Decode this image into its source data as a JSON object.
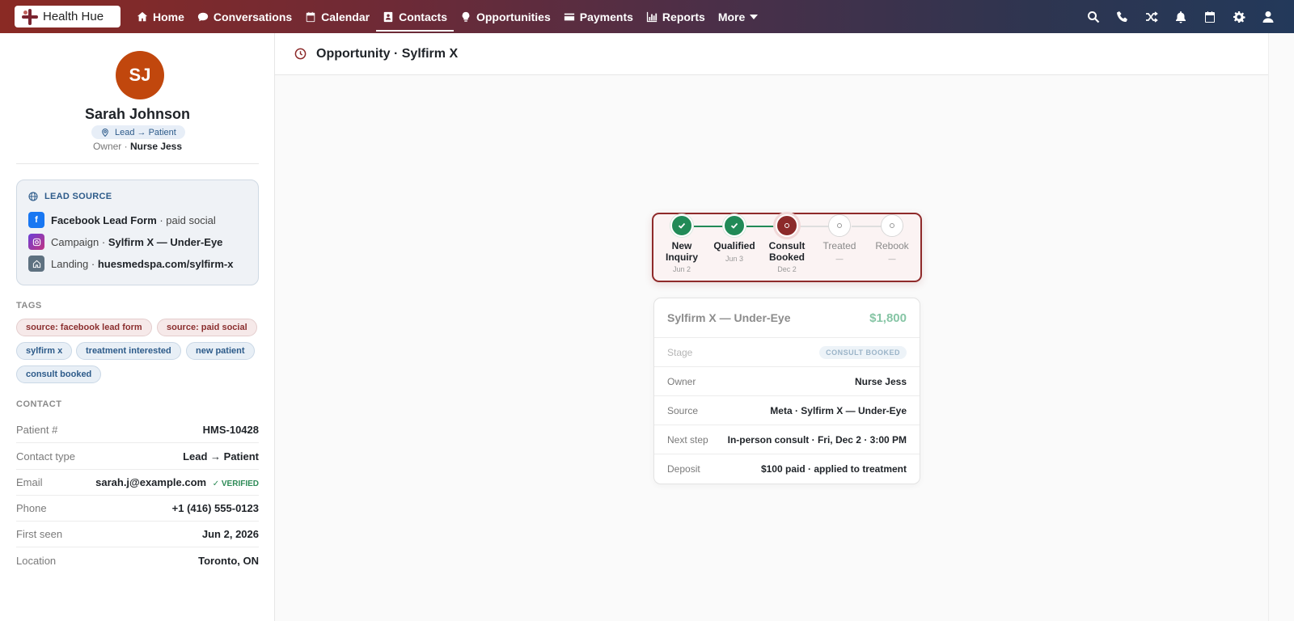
{
  "brand": {
    "name": "Health Hue"
  },
  "nav": {
    "items": [
      {
        "label": "Home",
        "icon": "home-icon"
      },
      {
        "label": "Conversations",
        "icon": "chat-icon"
      },
      {
        "label": "Calendar",
        "icon": "calendar-icon"
      },
      {
        "label": "Contacts",
        "icon": "contacts-icon",
        "active": true
      },
      {
        "label": "Opportunities",
        "icon": "lightbulb-icon"
      },
      {
        "label": "Payments",
        "icon": "credit-card-icon"
      },
      {
        "label": "Reports",
        "icon": "bar-chart-icon"
      },
      {
        "label": "More",
        "icon": "chevron-down-icon"
      }
    ],
    "right_icons": [
      "search-icon",
      "phone-icon",
      "shuffle-icon",
      "bell-icon",
      "calendar-icon",
      "gear-icon",
      "user-icon"
    ]
  },
  "contact": {
    "initials": "SJ",
    "name": "Sarah Johnson",
    "type_pill": "Lead → Patient",
    "owner_label": "Owner ·",
    "owner": "Nurse Jess",
    "avatar_color": "#c1470d"
  },
  "lead_source": {
    "heading": "LEAD SOURCE",
    "rows": [
      {
        "icon": "facebook-icon",
        "bold": "Facebook Lead Form",
        "after": " · paid social",
        "before": ""
      },
      {
        "icon": "instagram-icon",
        "before": "Campaign · ",
        "bold": "Sylfirm X — Under-Eye",
        "after": ""
      },
      {
        "icon": "home-icon",
        "before": "Landing · ",
        "bold": "huesmedspa.com/sylfirm-x",
        "after": ""
      }
    ]
  },
  "tags": {
    "heading": "TAGS",
    "items": [
      {
        "label": "source: facebook lead form",
        "tone": "red"
      },
      {
        "label": "source: paid social",
        "tone": "red"
      },
      {
        "label": "sylfirm x",
        "tone": "blue"
      },
      {
        "label": "treatment interested",
        "tone": "blue"
      },
      {
        "label": "new patient",
        "tone": "blue"
      },
      {
        "label": "consult booked",
        "tone": "blue"
      }
    ]
  },
  "contact_info": {
    "heading": "CONTACT",
    "rows": [
      {
        "label": "Patient #",
        "value": "HMS-10428"
      },
      {
        "label": "Contact type",
        "value": "Lead → Patient"
      },
      {
        "label": "Email",
        "value": "sarah.j@example.com",
        "badge": "✓ VERIFIED"
      },
      {
        "label": "Phone",
        "value": "+1 (416) 555-0123"
      },
      {
        "label": "First seen",
        "value": "Jun 2, 2026"
      },
      {
        "label": "Location",
        "value": "Toronto, ON"
      }
    ]
  },
  "page": {
    "title": "Opportunity · Sylfirm X"
  },
  "pipeline": {
    "steps": [
      {
        "label": "New Inquiry",
        "date": "Jun 2",
        "state": "done"
      },
      {
        "label": "Qualified",
        "date": "Jun 3",
        "state": "done"
      },
      {
        "label": "Consult Booked",
        "date": "Dec 2",
        "state": "current"
      },
      {
        "label": "Treated",
        "date": "—",
        "state": "todo"
      },
      {
        "label": "Rebook",
        "date": "—",
        "state": "todo"
      }
    ]
  },
  "opportunity": {
    "title": "Sylfirm X — Under-Eye",
    "amount": "$1,800",
    "rows": [
      {
        "label": "Stage",
        "value": "CONSULT BOOKED",
        "pill": true
      },
      {
        "label": "Owner",
        "value": "Nurse Jess"
      },
      {
        "label": "Source",
        "value": "Meta · Sylfirm X — Under-Eye"
      },
      {
        "label": "Next step",
        "value": "In-person consult · Fri, Dec 2 · 3:00 PM"
      },
      {
        "label": "Deposit",
        "value": "$100 paid · applied to treatment"
      }
    ]
  }
}
